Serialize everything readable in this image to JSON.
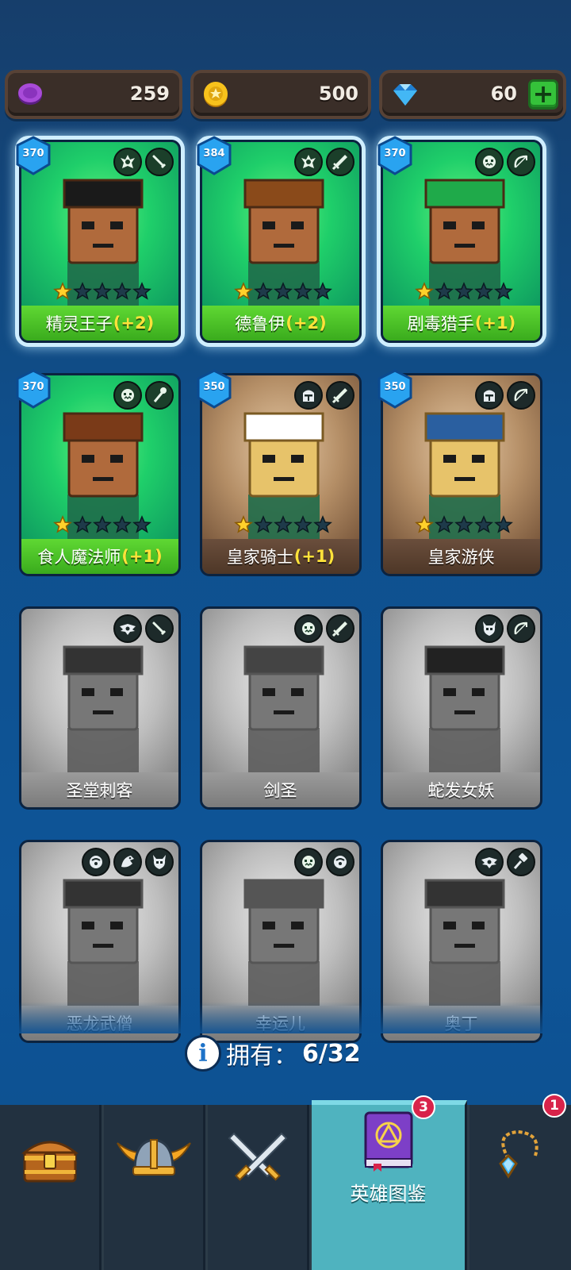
{
  "currencies": [
    {
      "name": "purple-token",
      "icon": "purple-token-icon",
      "value": "259",
      "color": "#9b3fcf"
    },
    {
      "name": "gold-coin",
      "icon": "gold-coin-icon",
      "value": "500",
      "color": "#f2b80f"
    },
    {
      "name": "gem",
      "icon": "blue-gem-icon",
      "value": "60",
      "color": "#3fb6f5",
      "has_plus": true
    }
  ],
  "heroes": [
    {
      "id": "elf-prince",
      "name": "精灵王子",
      "bonus": "(+2)",
      "level": "370",
      "theme": "green",
      "selected": true,
      "stars": 1,
      "owned": true,
      "icons": [
        "elf-icon",
        "dagger-icon"
      ]
    },
    {
      "id": "druid",
      "name": "德鲁伊",
      "bonus": "(+2)",
      "level": "384",
      "theme": "green",
      "selected": true,
      "stars": 1,
      "owned": true,
      "icons": [
        "elf-icon",
        "sword-icon"
      ]
    },
    {
      "id": "poison-hunter",
      "name": "剧毒猎手",
      "bonus": "(+1)",
      "level": "370",
      "theme": "green",
      "selected": true,
      "stars": 1,
      "owned": true,
      "icons": [
        "orc-icon",
        "bow-icon"
      ]
    },
    {
      "id": "ogre-mage",
      "name": "食人魔法师",
      "bonus": "(+1)",
      "level": "370",
      "theme": "green",
      "selected": false,
      "stars": 1,
      "owned": true,
      "icons": [
        "orc-icon",
        "staff-icon"
      ]
    },
    {
      "id": "royal-knight",
      "name": "皇家骑士",
      "bonus": "(+1)",
      "level": "350",
      "theme": "brown",
      "selected": false,
      "stars": 1,
      "owned": true,
      "icons": [
        "knight-helmet-icon",
        "sword-icon"
      ]
    },
    {
      "id": "royal-ranger",
      "name": "皇家游侠",
      "bonus": "",
      "level": "350",
      "theme": "brown",
      "selected": false,
      "stars": 1,
      "owned": true,
      "icons": [
        "knight-helmet-icon",
        "bow-icon"
      ]
    },
    {
      "id": "temple-assassin",
      "name": "圣堂刺客",
      "bonus": "",
      "level": "",
      "theme": "gray",
      "selected": false,
      "stars": 0,
      "owned": false,
      "icons": [
        "winged-emblem-icon",
        "dagger-icon"
      ]
    },
    {
      "id": "sword-saint",
      "name": "剑圣",
      "bonus": "",
      "level": "",
      "theme": "gray",
      "selected": false,
      "stars": 0,
      "owned": false,
      "icons": [
        "orc-icon",
        "sword-icon"
      ]
    },
    {
      "id": "medusa",
      "name": "蛇发女妖",
      "bonus": "",
      "level": "",
      "theme": "gray",
      "selected": false,
      "stars": 0,
      "owned": false,
      "icons": [
        "demon-skull-icon",
        "bow-icon"
      ]
    },
    {
      "id": "dragon-monk",
      "name": "恶龙武僧",
      "bonus": "",
      "level": "",
      "theme": "gray",
      "selected": false,
      "stars": 0,
      "owned": false,
      "icons": [
        "monk-icon",
        "dragon-icon",
        "demon-skull-icon"
      ]
    },
    {
      "id": "lucky-one",
      "name": "幸运儿",
      "bonus": "",
      "level": "",
      "theme": "gray",
      "selected": false,
      "stars": 0,
      "owned": false,
      "icons": [
        "orc-icon",
        "monk-icon"
      ]
    },
    {
      "id": "odin",
      "name": "奥丁",
      "bonus": "",
      "level": "",
      "theme": "gray",
      "selected": false,
      "stars": 0,
      "owned": false,
      "icons": [
        "winged-emblem-icon",
        "hammer-icon"
      ]
    }
  ],
  "owned_summary": {
    "label": "拥有：",
    "value": "6/32"
  },
  "bottom_nav": {
    "tabs": [
      {
        "id": "shop",
        "icon": "treasure-chest-icon",
        "label": "",
        "active": false,
        "badge": ""
      },
      {
        "id": "heroes",
        "icon": "viking-helmet-icon",
        "label": "",
        "active": false,
        "badge": ""
      },
      {
        "id": "battle",
        "icon": "crossed-swords-icon",
        "label": "",
        "active": false,
        "badge": ""
      },
      {
        "id": "hero-codex",
        "icon": "codex-book-icon",
        "label": "英雄图鉴",
        "active": true,
        "badge": "3"
      },
      {
        "id": "equipment",
        "icon": "amulet-icon",
        "label": "",
        "active": false,
        "badge": "1"
      }
    ]
  }
}
